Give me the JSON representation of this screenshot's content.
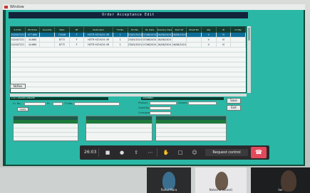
{
  "window": {
    "title": "Window"
  },
  "app": {
    "title": "Order Acceptance Edit",
    "grid": {
      "columns": [
        "S.O.No.",
        "Wt.Order",
        "Quantity",
        "Rate",
        "Mt",
        "Particulars",
        "T.O.No.",
        "P.O.No.",
        "Dt. Date",
        "Delivery Date",
        "Start Dt",
        "Sheet No",
        "Qty",
        "ID",
        "Gr.Qty"
      ],
      "rows": [
        [
          "202407221",
          "477.660",
          "",
          "72046",
          "F",
          "HZTR HZ19/34 UR",
          "1",
          "23/05/2024",
          "07/06/2024",
          "16/06/2024",
          "16/06/2024",
          "",
          "V",
          "N",
          ""
        ],
        [
          "202407221",
          "44.660",
          "",
          "8772",
          "F",
          "HZTR HZ19/34 UR",
          "1",
          "23/05/2024",
          "07/06/2024",
          "16/06/2024",
          "",
          "",
          "V",
          "N",
          ""
        ],
        [
          "202407221",
          "44.660",
          "",
          "8772",
          "F",
          "HZTR HZ19/34 UR",
          "1",
          "23/05/2024",
          "07/06/2024",
          "16/06/2024",
          "16/06/2024",
          "",
          "V",
          "N",
          ""
        ]
      ]
    },
    "grid_button": "NcRes",
    "bottom": {
      "left_header": "L.O.I. VALUES UPDATE",
      "right_header": "ASSEMBLY",
      "field_labels": [
        "Cr. No.",
        "Pr.",
        "T.O.No.",
        "Product",
        "Invoice",
        "Quantity",
        "Consignee"
      ],
      "btn_left": "Apply",
      "btn_save": "Save",
      "btn_exit": "Exit",
      "panel_labels": [
        "Material",
        "Product",
        "Remarks",
        "Sr.No",
        "Grn Qty",
        "Physical",
        "Invoice",
        "Status"
      ]
    }
  },
  "taskbar": {
    "time": "26:03",
    "request_label": "Request control",
    "icons": [
      "camera-icon",
      "mic-icon",
      "share-icon",
      "more-icon",
      "hand-icon",
      "chat-icon",
      "reactions-icon",
      "hangup-icon"
    ]
  },
  "participants": [
    {
      "name": "Rahul Mora"
    },
    {
      "name": "Natesha (Guest)"
    },
    {
      "name": "Ian"
    }
  ]
}
